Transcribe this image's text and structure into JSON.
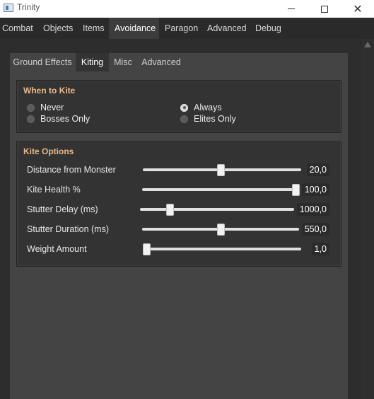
{
  "window": {
    "title": "Trinity"
  },
  "top_tabs": [
    {
      "label": "Combat",
      "active": false
    },
    {
      "label": "Objects",
      "active": false
    },
    {
      "label": "Items",
      "active": false
    },
    {
      "label": "Avoidance",
      "active": true
    },
    {
      "label": "Paragon",
      "active": false
    },
    {
      "label": "Advanced",
      "active": false
    },
    {
      "label": "Debug",
      "active": false
    }
  ],
  "sub_tabs": [
    {
      "label": "Ground Effects",
      "active": false
    },
    {
      "label": "Kiting",
      "active": true
    },
    {
      "label": "Misc",
      "active": false
    },
    {
      "label": "Advanced",
      "active": false
    }
  ],
  "when_to_kite": {
    "title": "When to Kite",
    "options": [
      {
        "label": "Never",
        "checked": false
      },
      {
        "label": "Bosses Only",
        "checked": false
      },
      {
        "label": "Always",
        "checked": true
      },
      {
        "label": "Elites Only",
        "checked": false
      }
    ]
  },
  "kite_options": {
    "title": "Kite Options",
    "rows": [
      {
        "label": "Distance from Monster",
        "value": "20,0",
        "fraction": 0.49
      },
      {
        "label": "Kite Health %",
        "value": "100,0",
        "fraction": 1.0
      },
      {
        "label": "Stutter Delay (ms)",
        "value": "1000,0",
        "fraction": 0.18
      },
      {
        "label": "Stutter Duration (ms)",
        "value": "550,0",
        "fraction": 0.5
      },
      {
        "label": "Weight Amount",
        "value": "1,0",
        "fraction": 0.0
      }
    ]
  },
  "colors": {
    "group_title": "#e8b98a",
    "background": "#2d2d2d",
    "panel": "#444444"
  }
}
